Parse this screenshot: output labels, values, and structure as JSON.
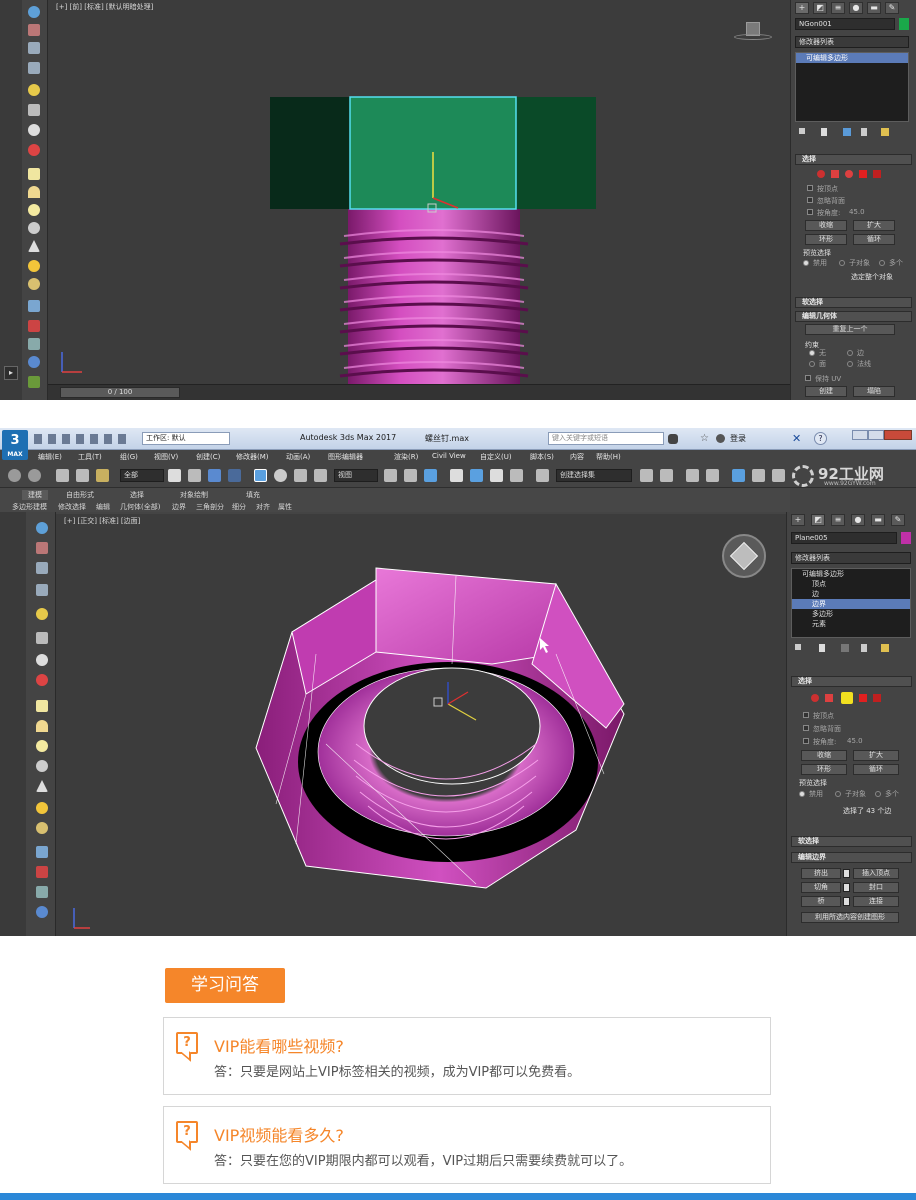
{
  "shot_top": {
    "viewport_label": "[+] [前] [标准] [默认明暗处理]",
    "timeline": "0 / 100",
    "object_name": "NGon001",
    "modifier_list": "修改器列表",
    "stack_items": [
      "可编辑多边形"
    ],
    "rollout_select": "选择",
    "by_vertex": "按顶点",
    "ignore_backfacing": "忽略背面",
    "by_angle": "按角度:",
    "angle_value": "45.0",
    "shrink": "收缩",
    "grow": "扩大",
    "ring": "环形",
    "loop": "循环",
    "preview_select": "预览选择",
    "disabled": "禁用",
    "subobject": "子对象",
    "multi": "多个",
    "selected_whole": "选定整个对象",
    "rollout_soft": "软选择",
    "rollout_edit_geom": "编辑几何体",
    "repeat_last": "重复上一个",
    "constraints": "约束",
    "c_none": "无",
    "c_edge": "边",
    "c_face": "面",
    "c_normal": "法线",
    "preserve_uv": "保持 UV",
    "create": "创建",
    "collapse": "塌陷"
  },
  "shot_bottom": {
    "title_center": "Autodesk 3ds Max 2017",
    "file_name": "螺丝钉.max",
    "workspace": "工作区: 默认",
    "search_placeholder": "键入关键字或短语",
    "login": "登录",
    "menus": [
      "编辑(E)",
      "工具(T)",
      "组(G)",
      "视图(V)",
      "创建(C)",
      "修改器(M)",
      "动画(A)",
      "图形编辑器",
      "渲染(R)",
      "Civil View",
      "自定义(U)",
      "脚本(S)",
      "内容",
      "帮助(H)"
    ],
    "toolbar_all": "全部",
    "toolbar_view": "视图",
    "toolbar_selset": "创建选择集",
    "ribbon_tabs": [
      "建模",
      "自由形式",
      "选择",
      "对象绘制",
      "填充"
    ],
    "ribbon_sub": [
      "多边形建模",
      "修改选择",
      "编辑",
      "几何体(全部)",
      "边界",
      "三角剖分",
      "细分",
      "对齐",
      "属性"
    ],
    "viewport_label": "[+] [正交] [标准] [边面]",
    "watermark": "92工业网",
    "watermark_url": "www.92GYW.com",
    "object_name": "Plane005",
    "modifier_list": "修改器列表",
    "stack_items": [
      "可编辑多边形",
      "顶点",
      "边",
      "边界",
      "多边形",
      "元素"
    ],
    "stack_selected": "边界",
    "rollout_select": "选择",
    "by_vertex": "按顶点",
    "ignore_backfacing": "忽略背面",
    "by_angle": "按角度:",
    "angle_value": "45.0",
    "shrink": "收缩",
    "grow": "扩大",
    "ring": "环形",
    "loop": "循环",
    "preview_select": "预览选择",
    "disabled": "禁用",
    "subobject": "子对象",
    "multi": "多个",
    "selection_count": "选择了 43 个边",
    "rollout_soft": "软选择",
    "rollout_edit_border": "编辑边界",
    "extrude": "挤出",
    "insert_vertex": "插入顶点",
    "chamfer": "切角",
    "cap": "封口",
    "bridge": "桥",
    "connect": "连接",
    "create_shape": "利用所选内容创建图形"
  },
  "qa": {
    "heading": "学习问答",
    "items": [
      {
        "q": "VIP能看哪些视频?",
        "a": "答：只要是网站上VIP标签相关的视频，成为VIP都可以免费看。"
      },
      {
        "q": "VIP视频能看多久?",
        "a": "答：只要在您的VIP期限内都可以观看，VIP过期后只需要续费就可以了。"
      }
    ]
  },
  "colors": {
    "accent_orange": "#f5862a",
    "max_gray": "#444444",
    "viewport": "#3c3c3c",
    "magenta": "#c02ca8",
    "bottom_bar": "#2b88d8"
  }
}
